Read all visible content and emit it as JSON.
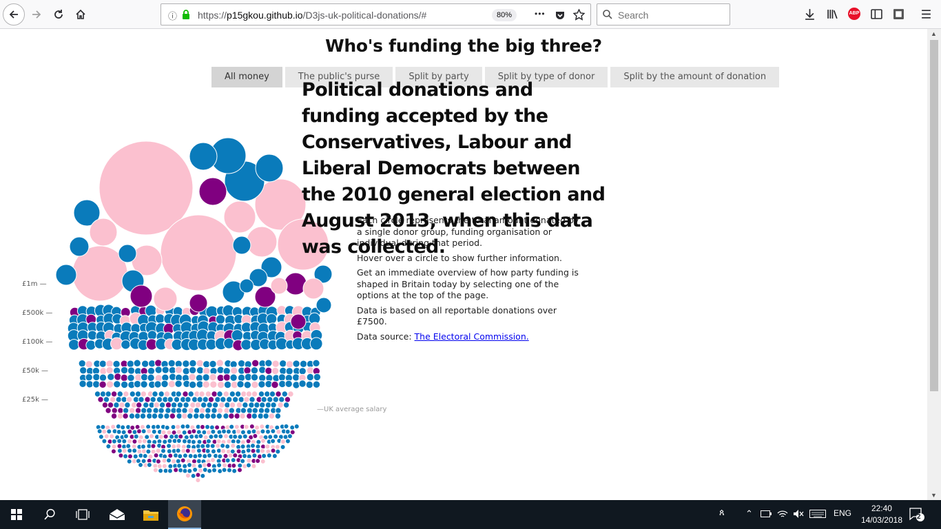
{
  "browser": {
    "url_prefix": "https://",
    "url_host": "p15gkou.github.io",
    "url_path": "/D3js-uk-political-donations/#",
    "zoom": "80%",
    "search_placeholder": "Search",
    "menu_dots": "•••"
  },
  "page": {
    "title": "Who's funding the big three?",
    "tabs": [
      "All money",
      "The public's purse",
      "Split by party",
      "Split by type of donor",
      "Split by the amount of donation"
    ],
    "active_tab": "All money",
    "headline": "Political donations and funding accepted by the Conservatives, Labour and Liberal Democrats between the 2010 general election and August 2013, when this data was collected.",
    "info": {
      "p1": "Each circle represents the total amount donated by a single donor group, funding organisation or individual during that period.",
      "p2": "Hover over a circle to show further information.",
      "p3": "Get an immediate overview of how party funding is shaped in Britain today by selecting one of the options at the top of the page.",
      "p4": "Data is based on all reportable donations over £7500.",
      "source_label": "Data source:",
      "source_link": "The Electoral Commission."
    },
    "axis_labels": [
      "£1m —",
      "£500k —",
      "£100k —",
      "£50k —",
      "£25k —"
    ],
    "salary_label": "—UK average salary"
  },
  "colors": {
    "labour": "#fbc0cf",
    "conservative": "#0a7bbb",
    "libdem": "#800080"
  },
  "taskbar": {
    "language": "ENG",
    "time": "22:40",
    "date": "14/03/2018",
    "notifications": "2"
  }
}
